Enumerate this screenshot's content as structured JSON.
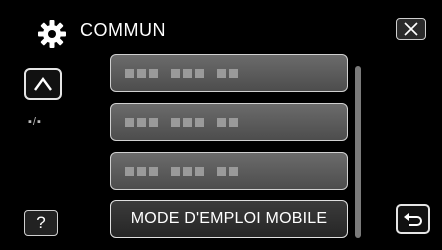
{
  "header": {
    "title": "COMMUN",
    "gear_icon": "gear-icon",
    "close_icon": "close-icon"
  },
  "nav": {
    "up_icon": "chevron-up-icon",
    "page_indicator": "▪/▪"
  },
  "menu": {
    "items": [
      {
        "label": ""
      },
      {
        "label": ""
      },
      {
        "label": ""
      },
      {
        "label": "MODE D'EMPLOI MOBILE"
      }
    ]
  },
  "footer": {
    "help_label": "?",
    "back_icon": "return-arrow-icon"
  },
  "colors": {
    "background": "#000000",
    "button_gradient_top": "#6b6b6b",
    "button_gradient_bottom": "#4d4d4d",
    "button_border": "#d0d0d0"
  }
}
